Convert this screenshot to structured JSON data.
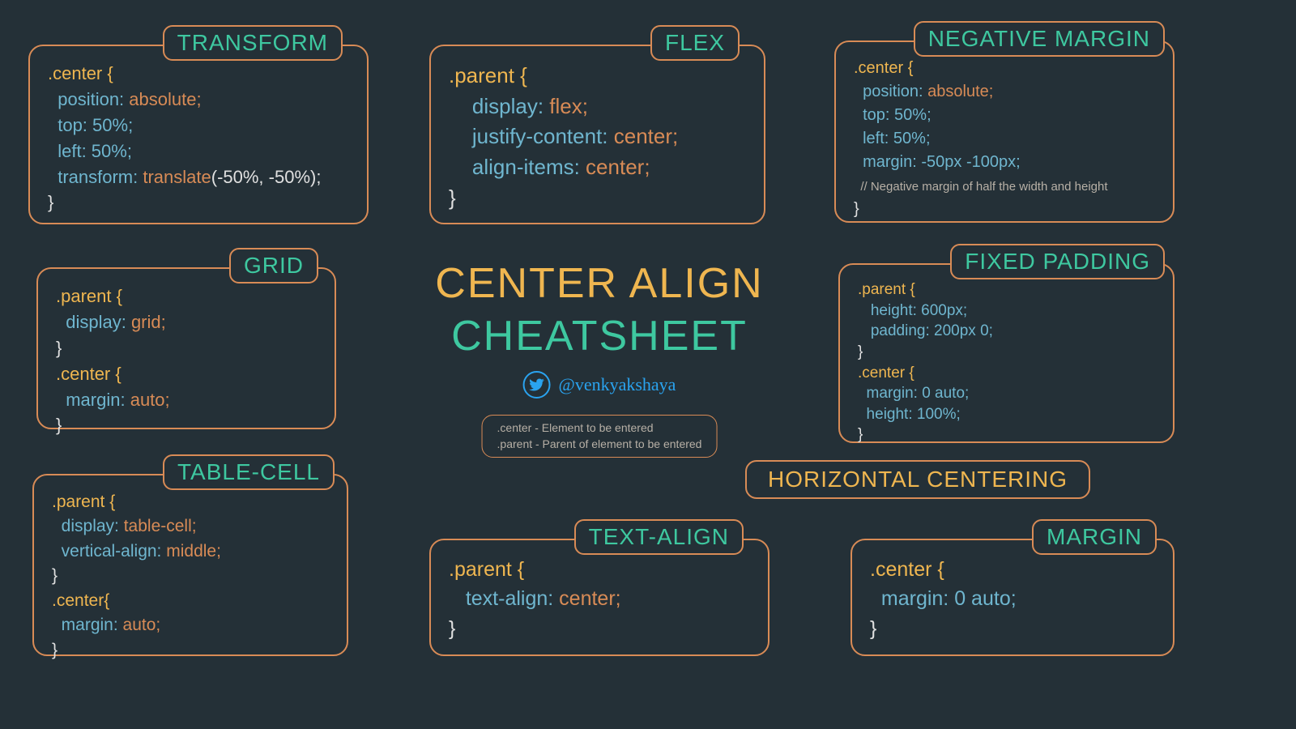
{
  "title": {
    "line1": "CENTER ALIGN",
    "line2": "CHEATSHEET"
  },
  "handle": "@venkyakshaya",
  "legend": {
    "line1": ".center - Element to be entered",
    "line2": ".parent - Parent of element to be entered"
  },
  "section_horizontal": "HORIZONTAL CENTERING",
  "cards": {
    "transform": {
      "label": "TRANSFORM",
      "lines": {
        "l0": ".center {",
        "l1_prop": "  position:",
        "l1_val": " absolute;",
        "l2_prop": "  top:",
        "l2_val": " 50%;",
        "l3_prop": "  left:",
        "l3_val": " 50%;",
        "l4_prop": "  transform:",
        "l4_fn": " translate",
        "l4_args": "(-50%, -50%);",
        "l5": "}"
      }
    },
    "flex": {
      "label": "FLEX",
      "lines": {
        "l0": ".parent {",
        "l1_prop": "    display:",
        "l1_val": " flex;",
        "l2_prop": "    justify-content:",
        "l2_val": " center;",
        "l3_prop": "    align-items:",
        "l3_val": " center;",
        "l4": "}"
      }
    },
    "negmargin": {
      "label": "NEGATIVE MARGIN",
      "lines": {
        "l0": ".center {",
        "l1_prop": "  position:",
        "l1_val": " absolute;",
        "l2_prop": "  top:",
        "l2_val": " 50%;",
        "l3_prop": "  left:",
        "l3_val": " 50%;",
        "l4_prop": "  margin:",
        "l4_val": " -50px -100px;",
        "comment": "  // Negative margin of half the width and height",
        "l5": "}"
      }
    },
    "grid": {
      "label": "GRID",
      "lines": {
        "l0": ".parent {",
        "l1_prop": "  display:",
        "l1_val": " grid;",
        "l2": "}",
        "l3": ".center {",
        "l4_prop": "  margin:",
        "l4_val": " auto;",
        "l5": "}"
      }
    },
    "fixedpadding": {
      "label": "FIXED PADDING",
      "lines": {
        "l0": ".parent {",
        "l1_prop": "   height:",
        "l1_val": " 600px;",
        "l2_prop": "   padding:",
        "l2_val": " 200px 0;",
        "l3": "}",
        "l4": ".center {",
        "l5_prop": "  margin:",
        "l5_val": " 0 auto;",
        "l6_prop": "  height:",
        "l6_val": " 100%;",
        "l7": "}"
      }
    },
    "tablecell": {
      "label": "TABLE-CELL",
      "lines": {
        "l0": ".parent {",
        "l1_prop": "  display:",
        "l1_val": " table-cell;",
        "l2_prop": "  vertical-align:",
        "l2_val": " middle;",
        "l3": "}",
        "l4": ".center{",
        "l5_prop": "  margin:",
        "l5_val": " auto;",
        "l6": "}"
      }
    },
    "textalign": {
      "label": "TEXT-ALIGN",
      "lines": {
        "l0": ".parent {",
        "l1_prop": "   text-align:",
        "l1_val": " center;",
        "l2": "}"
      }
    },
    "margin": {
      "label": "MARGIN",
      "lines": {
        "l0": ".center {",
        "l1_prop": "  margin:",
        "l1_val": " 0 auto;",
        "l2": "}"
      }
    }
  }
}
